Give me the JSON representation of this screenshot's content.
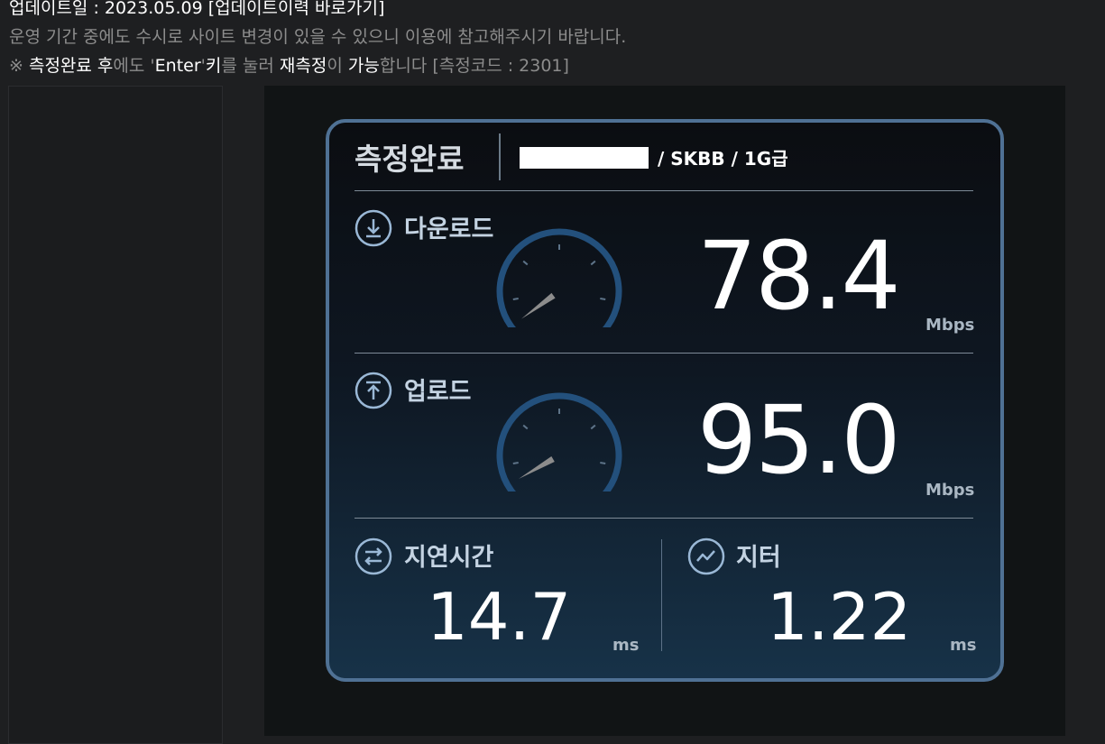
{
  "header": {
    "update_line": "업데이트일 : 2023.05.09 [업데이트이력 바로가기]",
    "notice_line": "운영 기간 중에도 수시로 사이트 변경이 있을 수 있으니 이용에 참고해주시기 바랍니다.",
    "tip": {
      "mark": "※ ",
      "complete": "측정완료 후",
      "t1": "에도 '",
      "enter": "Enter",
      "t2": "'",
      "key": "키",
      "t3": "를 눌러 ",
      "retest": "재측정",
      "t4": "이 ",
      "possible": "가능",
      "t5": "합니다 [측정코드 : 2301]"
    }
  },
  "result": {
    "title": "측정완료",
    "isp_info": "/ SKBB / 1G급",
    "download": {
      "label": "다운로드",
      "value": "78.4",
      "unit": "Mbps",
      "gauge_fraction": 0.08
    },
    "upload": {
      "label": "업로드",
      "value": "95.0",
      "unit": "Mbps",
      "gauge_fraction": 0.1
    },
    "latency": {
      "label": "지연시간",
      "value": "14.7",
      "unit": "ms"
    },
    "jitter": {
      "label": "지터",
      "value": "1.22",
      "unit": "ms"
    }
  },
  "colors": {
    "panel_border": "#4f7194",
    "gauge_arc": "#23507c",
    "accent_icon": "#9ab8d6",
    "value_text": "#ffffff"
  },
  "icons": {
    "download": "download-circle-icon",
    "upload": "upload-circle-icon",
    "latency": "swap-arrows-circle-icon",
    "jitter": "wave-circle-icon"
  }
}
